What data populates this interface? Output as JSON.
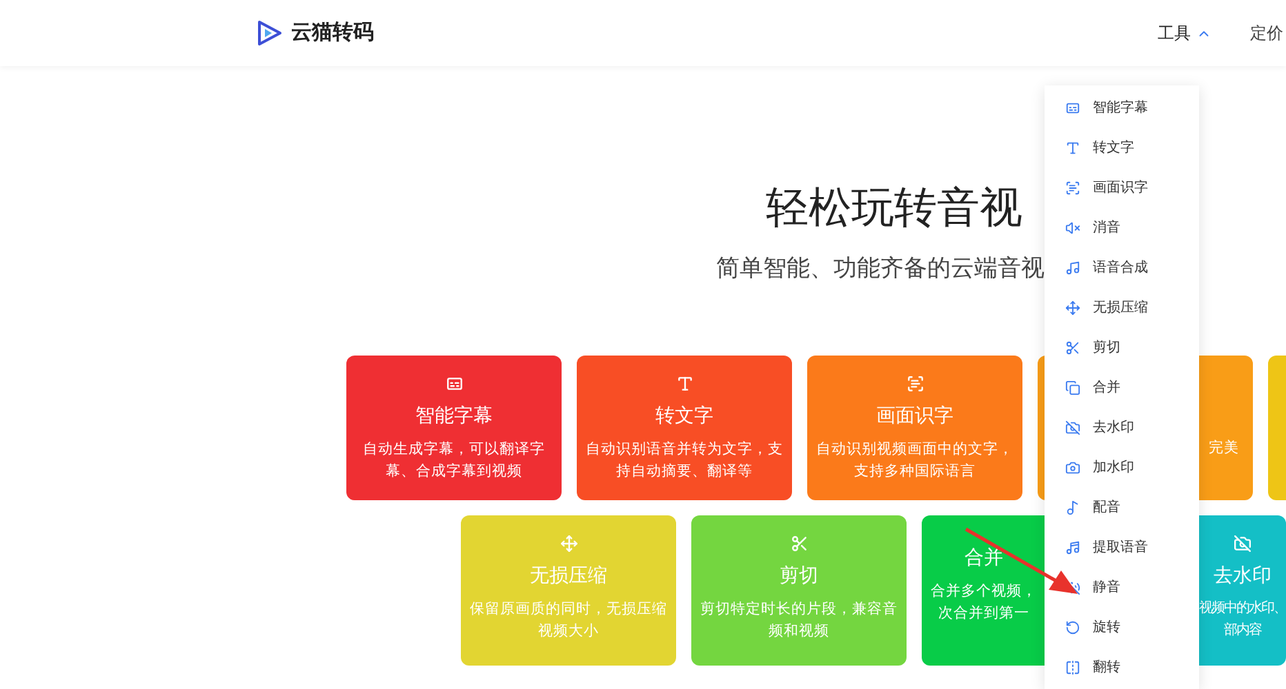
{
  "header": {
    "logo_text": "云猫转码",
    "nav": [
      {
        "label": "工具",
        "expanded": true
      },
      {
        "label": "定价",
        "expanded": false
      }
    ]
  },
  "hero": {
    "title": "轻松玩转音视",
    "subtitle": "简单智能、功能齐备的云端音视"
  },
  "card_rows": [
    {
      "cards": [
        {
          "title": "智能字幕",
          "description": [
            "自动生成字幕，可以翻译字",
            "幕、合成字幕到视频"
          ],
          "color": "#ef2f33"
        },
        {
          "title": "转文字",
          "description": [
            "自动识别语音并转为文字，支",
            "持自动摘要、翻译等"
          ],
          "color": "#f84e25"
        },
        {
          "title": "画面识字",
          "description": [
            "自动识别视频画面中的文字，",
            "支持多种国际语言"
          ],
          "color": "#fb7a1a"
        },
        {
          "description": [
            "完美"
          ],
          "color": "#f99d17"
        },
        {
          "color": "#eec516"
        }
      ]
    },
    {
      "cards": [
        {
          "title": "无损压缩",
          "description": [
            "保留原画质的同时，无损压缩",
            "视频大小"
          ],
          "color": "#e2d532"
        },
        {
          "title": "剪切",
          "description": [
            "剪切特定时长的片段，兼容音",
            "频和视频"
          ],
          "color": "#74d640"
        },
        {
          "title": "合并",
          "description": [
            "合并多个视频，",
            "次合并到第一"
          ],
          "color": "#08cc48"
        },
        {
          "title": "去水印",
          "description": [
            "视频中的水印、",
            "部内容"
          ],
          "color": "#14bfc6"
        }
      ]
    }
  ],
  "dropdown": {
    "items": [
      {
        "label": "智能字幕"
      },
      {
        "label": "转文字"
      },
      {
        "label": "画面识字"
      },
      {
        "label": "消音"
      },
      {
        "label": "语音合成"
      },
      {
        "label": "无损压缩"
      },
      {
        "label": "剪切"
      },
      {
        "label": "合并"
      },
      {
        "label": "去水印"
      },
      {
        "label": "加水印"
      },
      {
        "label": "配音"
      },
      {
        "label": "提取语音"
      },
      {
        "label": "静音"
      },
      {
        "label": "旋转"
      },
      {
        "label": "翻转"
      }
    ]
  }
}
